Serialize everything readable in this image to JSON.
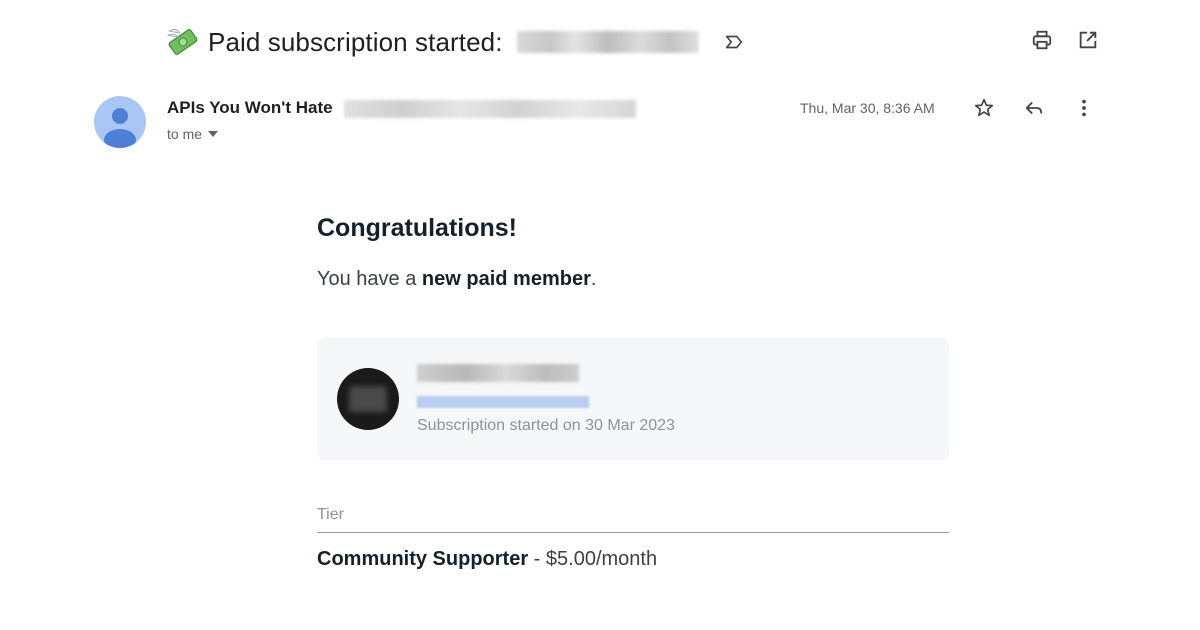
{
  "subject": {
    "emoji_icon": "money-with-wings-icon",
    "text": "Paid subscription started:"
  },
  "top_actions": {
    "print_icon": "printer-icon",
    "popout_icon": "open-in-new-icon"
  },
  "sender": {
    "name": "APIs You Won't Hate",
    "recipient": "to me",
    "date": "Thu, Mar 30, 8:36 AM"
  },
  "message_actions": {
    "star_icon": "star-icon",
    "reply_icon": "reply-icon",
    "more_icon": "more-vert-icon"
  },
  "body": {
    "heading": "Congratulations!",
    "intro_prefix": "You have a ",
    "intro_bold": "new paid member",
    "intro_suffix": ".",
    "member": {
      "subscription_started": "Subscription started on 30 Mar 2023"
    },
    "tier": {
      "label": "Tier",
      "name": "Community Supporter",
      "price": " - $5.00/month"
    }
  },
  "colors": {
    "avatar_bg": "#a9c6f5",
    "avatar_fg": "#4f7fd6",
    "card_bg": "#f6f7f8",
    "text_dark": "#15212a",
    "text_muted": "#8e9398"
  }
}
